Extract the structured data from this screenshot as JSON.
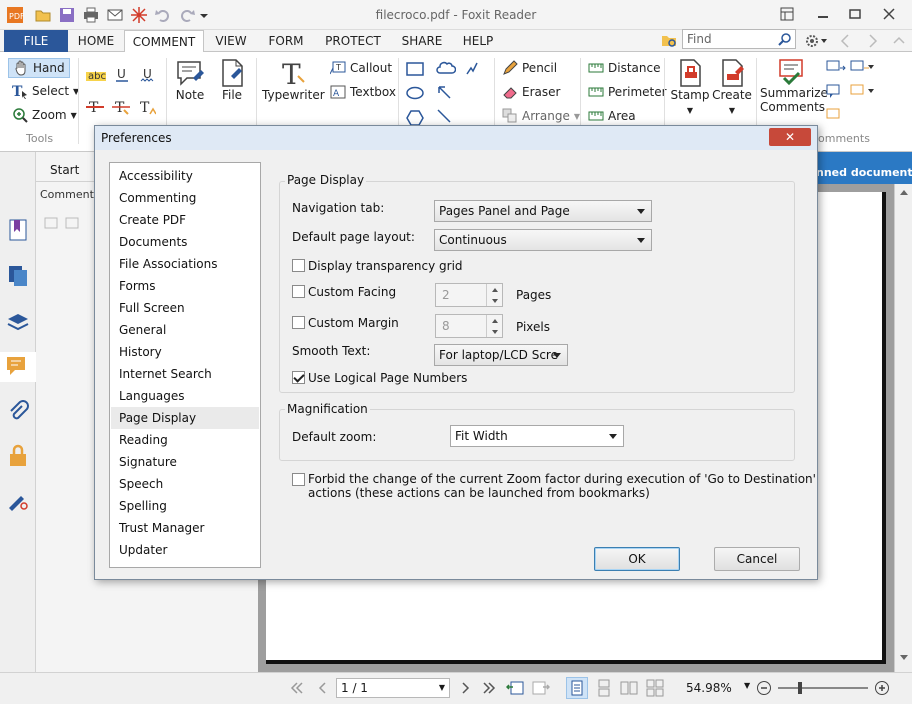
{
  "app": {
    "title": "filecroco.pdf - Foxit Reader"
  },
  "menu_tabs": [
    "FILE",
    "HOME",
    "COMMENT",
    "VIEW",
    "FORM",
    "PROTECT",
    "SHARE",
    "HELP"
  ],
  "find_placeholder": "Find",
  "ribbon": {
    "tools": {
      "hand": "Hand",
      "select": "Select",
      "zoom": "Zoom",
      "group": "Tools"
    },
    "note": "Note",
    "file": "File",
    "typewriter": "Typewriter",
    "callout": "Callout",
    "textbox": "Textbox",
    "pencil": "Pencil",
    "eraser": "Eraser",
    "arrange": "Arrange",
    "distance": "Distance",
    "perimeter": "Perimeter",
    "area": "Area",
    "stamp": "Stamp",
    "create": "Create",
    "summarize": "Summarize",
    "comments": "Comments",
    "comments_group": "omments"
  },
  "side": {
    "start_tab": "Start",
    "comments_tab": "Comments"
  },
  "banner_text": "nned documents",
  "dialog": {
    "title": "Preferences",
    "close": "✕",
    "categories": [
      "Accessibility",
      "Commenting",
      "Create PDF",
      "Documents",
      "File Associations",
      "Forms",
      "Full Screen",
      "General",
      "History",
      "Internet Search",
      "Languages",
      "Page Display",
      "Reading",
      "Signature",
      "Speech",
      "Spelling",
      "Trust Manager",
      "Updater"
    ],
    "selected": "Page Display",
    "page_display": {
      "legend": "Page Display",
      "nav_tab_label": "Navigation tab:",
      "nav_tab_value": "Pages Panel and Page",
      "layout_label": "Default page layout:",
      "layout_value": "Continuous",
      "transparency_label": "Display transparency grid",
      "custom_facing_label": "Custom Facing",
      "custom_facing_value": "2",
      "pages_unit": "Pages",
      "custom_margin_label": "Custom Margin",
      "custom_margin_value": "8",
      "pixels_unit": "Pixels",
      "smooth_label": "Smooth Text:",
      "smooth_value": "For laptop/LCD Scre",
      "logical_label": "Use Logical Page Numbers"
    },
    "magnification": {
      "legend": "Magnification",
      "zoom_label": "Default zoom:",
      "zoom_value": "Fit Width"
    },
    "forbid_line1": "Forbid the change of the current Zoom factor during execution of  'Go to Destination'",
    "forbid_line2": "actions (these actions can be launched from bookmarks)",
    "ok": "OK",
    "cancel": "Cancel"
  },
  "status": {
    "page": "1 / 1",
    "zoom": "54.98%"
  },
  "colors": {
    "accent": "#2b579a",
    "dialog_title_bg": "#dfe9f5",
    "close_red": "#c7493a"
  }
}
